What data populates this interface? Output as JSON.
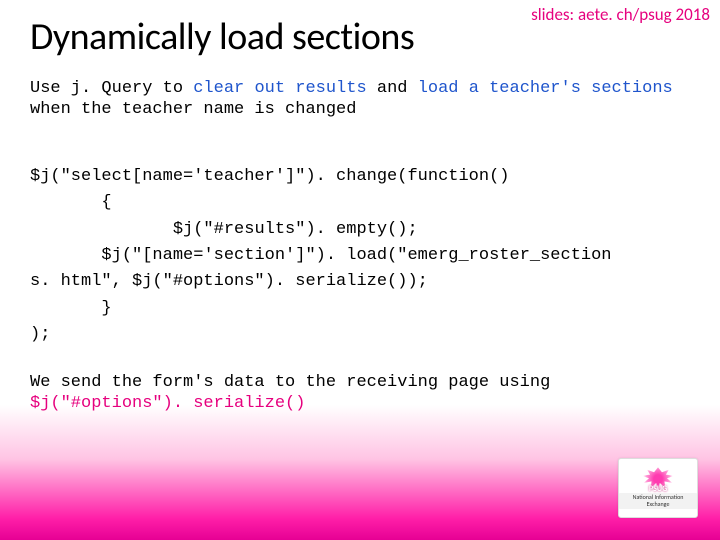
{
  "header": {
    "slides_link": "slides: aete. ch/psug 2018",
    "title": "Dynamically load sections"
  },
  "intro": {
    "t1": "Use j. Query to ",
    "t2": "clear out results",
    "t3": " and ",
    "t4": "load a teacher's sections",
    "t5": " when the teacher name is changed"
  },
  "code": {
    "l1": "$j(\"select[name='teacher']\"). change(function()",
    "l2": "       {",
    "l3": "              $j(\"#results\"). empty();",
    "l4a": "       $j(\"[name='section']\"). load(\"emerg_roster_section",
    "l4b": "s. html\", $j(\"#options\"). serialize());",
    "l5": "       }",
    "l6": ");"
  },
  "outro": {
    "t1": "We send the form's data to the receiving page using ",
    "t2": "$j(\"#options\"). serialize()"
  },
  "logo": {
    "brand": "PSUG",
    "caption": "National Information Exchange"
  }
}
